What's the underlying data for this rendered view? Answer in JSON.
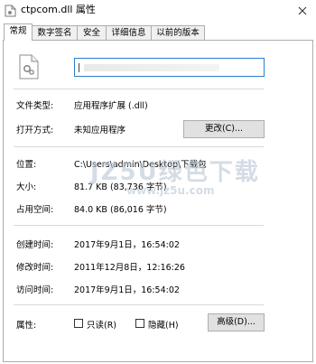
{
  "window": {
    "title": "ctpcom.dll 属性"
  },
  "tabs": [
    "常规",
    "数字签名",
    "安全",
    "详细信息",
    "以前的版本"
  ],
  "file": {
    "name_value": ""
  },
  "rows": {
    "type": {
      "label": "文件类型:",
      "value": "应用程序扩展 (.dll)"
    },
    "opens_with": {
      "label": "打开方式:",
      "value": "未知应用程序",
      "button": "更改(C)..."
    },
    "location": {
      "label": "位置:",
      "value": "C:\\Users\\admin\\Desktop\\下载包"
    },
    "size": {
      "label": "大小:",
      "value": "81.7 KB (83,736 字节)"
    },
    "size_on_disk": {
      "label": "占用空间:",
      "value": "84.0 KB (86,016 字节)"
    },
    "created": {
      "label": "创建时间:",
      "value": "2017年9月1日，16:54:02"
    },
    "modified": {
      "label": "修改时间:",
      "value": "2011年12月8日，12:16:26"
    },
    "accessed": {
      "label": "访问时间:",
      "value": "2017年9月1日，16:54:02"
    }
  },
  "attributes": {
    "label": "属性:",
    "readonly_label": "只读(R)",
    "readonly_checked": false,
    "hidden_label": "隐藏(H)",
    "hidden_checked": false,
    "advanced_button": "高级(D)..."
  },
  "watermark": {
    "main": "JZ5U绿色下载",
    "sub": "www.jz5u.com"
  }
}
